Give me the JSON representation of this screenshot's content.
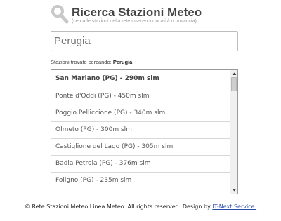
{
  "header": {
    "icon": "search-icon",
    "title": "Ricerca Stazioni Meteo",
    "subtitle": "(cerca le stazioni della rete inserendo località o provincia)"
  },
  "search": {
    "value": "",
    "placeholder": "Perugia"
  },
  "results": {
    "label": "Stazioni trovate cercando:",
    "query": "Perugia",
    "items": [
      "San Mariano (PG) - 290m slm",
      "Ponte d'Oddi (PG) - 450m slm",
      "Poggio Pelliccione (PG) - 340m slm",
      "Olmeto (PG) - 300m slm",
      "Castiglione del Lago (PG) - 305m slm",
      "Badia Petroia (PG) - 376m slm",
      "Foligno (PG) - 235m slm"
    ]
  },
  "footer": {
    "text": "© Rete Stazioni Meteo Linea Meteo. All rights reserved. Design by",
    "link": "IT-Next Service."
  },
  "colors": {
    "link": "#2a4ea8",
    "border": "#bdbdbd"
  }
}
